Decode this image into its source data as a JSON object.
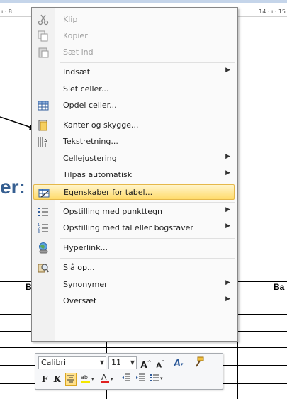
{
  "ruler": {
    "left_ticks": "ı · 8",
    "right_ticks": "14 · ı · 15"
  },
  "document": {
    "heading_fragment": "er:",
    "column_left": "B",
    "column_right": "Ba"
  },
  "menu": {
    "cut": "Klip",
    "copy": "Kopier",
    "paste": "Sæt ind",
    "insert": "Indsæt",
    "delete_cells": "Slet celler...",
    "split_cells": "Opdel celler...",
    "borders_shading": "Kanter og skygge...",
    "text_direction": "Tekstretning...",
    "cell_alignment": "Cellejustering",
    "autofit": "Tilpas automatisk",
    "table_properties": "Egenskaber for tabel...",
    "bullets": "Opstilling med punkttegn",
    "numbering": "Opstilling med tal eller bogstaver",
    "hyperlink": "Hyperlink...",
    "lookup": "Slå op...",
    "synonyms": "Synonymer",
    "translate": "Oversæt"
  },
  "mini_toolbar": {
    "font": "Calibri",
    "size": "11",
    "bold": "F",
    "italic": "K"
  },
  "colors": {
    "highlight": "#ffdb6b",
    "heading": "#365f91"
  }
}
